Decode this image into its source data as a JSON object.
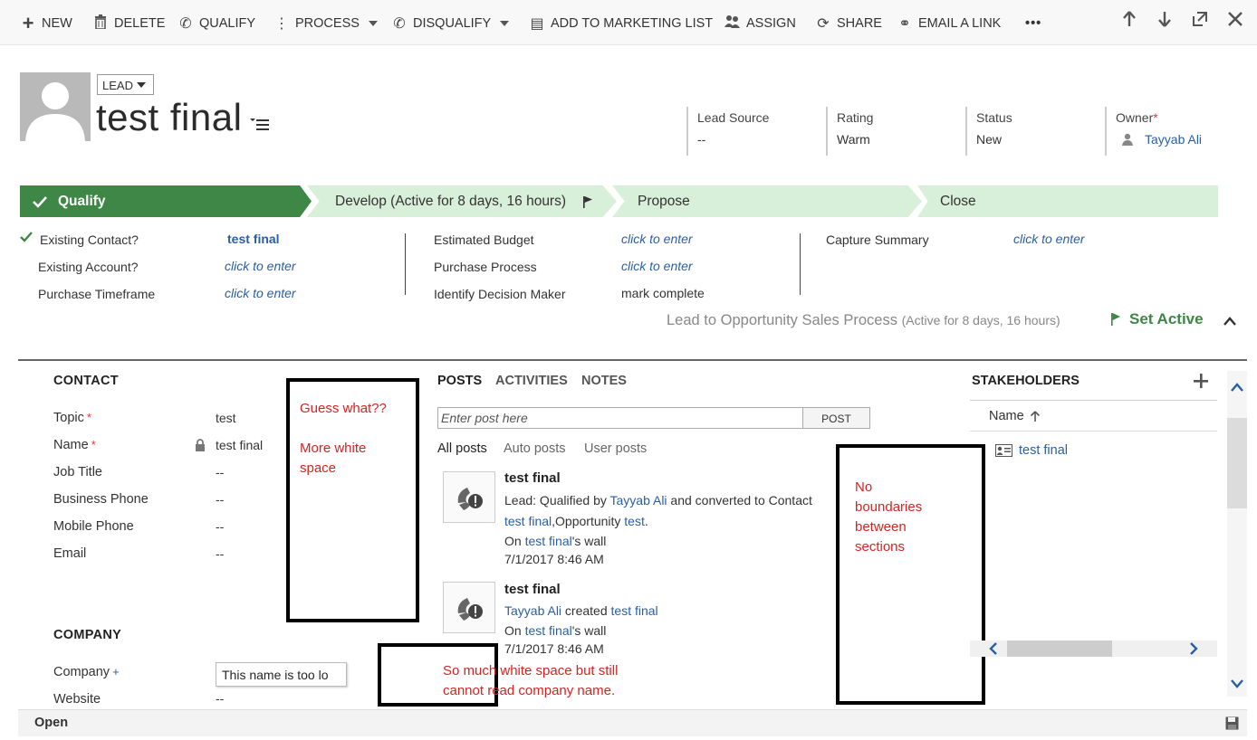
{
  "commands": [
    {
      "label": "NEW",
      "icon": "+"
    },
    {
      "label": "DELETE",
      "icon": "🗑"
    },
    {
      "label": "QUALIFY",
      "icon": "✆"
    },
    {
      "label": "PROCESS",
      "icon": "⋮"
    },
    {
      "label": "DISQUALIFY",
      "icon": "✆"
    },
    {
      "label": "ADD TO MARKETING LIST",
      "icon": "▤"
    },
    {
      "label": "ASSIGN",
      "icon": "👥"
    },
    {
      "label": "SHARE",
      "icon": "⟳"
    },
    {
      "label": "EMAIL A LINK",
      "icon": "⚭"
    },
    {
      "label": "•••",
      "icon": ""
    }
  ],
  "nav": {
    "up": "🡡",
    "down": "🡣",
    "popout": "⇱",
    "close": "✕"
  },
  "header": {
    "entity_type": "LEAD",
    "title": "test final",
    "fields": {
      "lead_source": {
        "label": "Lead Source",
        "value": "--"
      },
      "rating": {
        "label": "Rating",
        "value": "Warm"
      },
      "status": {
        "label": "Status",
        "value": "New"
      },
      "owner": {
        "label": "Owner",
        "required": "*",
        "value": "Tayyab Ali"
      }
    }
  },
  "process": {
    "stages": [
      "Qualify",
      "Develop (Active for 8 days, 16 hours)",
      "Propose",
      "Close"
    ],
    "steps": {
      "existing_contact": {
        "label": "Existing Contact?",
        "value": "test final"
      },
      "existing_account": {
        "label": "Existing Account?",
        "value": "click to enter"
      },
      "purchase_timeframe": {
        "label": "Purchase Timeframe",
        "value": "click to enter"
      },
      "estimated_budget": {
        "label": "Estimated Budget",
        "value": "click to enter"
      },
      "purchase_process": {
        "label": "Purchase Process",
        "value": "click to enter"
      },
      "identify_decision_maker": {
        "label": "Identify Decision Maker",
        "value": "mark complete"
      },
      "capture_summary": {
        "label": "Capture Summary",
        "value": "click to enter"
      }
    },
    "name": "Lead to Opportunity Sales Process",
    "active_note": "(Active for 8 days, 16 hours)",
    "set_active": "Set Active"
  },
  "contact": {
    "heading": "CONTACT",
    "fields": [
      {
        "label": "Topic",
        "required": "*",
        "value": "test"
      },
      {
        "label": "Name",
        "required": "*",
        "value": "test final"
      },
      {
        "label": "Job Title",
        "value": "--"
      },
      {
        "label": "Business Phone",
        "value": "--"
      },
      {
        "label": "Mobile Phone",
        "value": "--"
      },
      {
        "label": "Email",
        "value": "--"
      }
    ]
  },
  "company": {
    "heading": "COMPANY",
    "company_label": "Company",
    "company_req": "+",
    "company_value": "This name is too lo",
    "website_label": "Website",
    "website_value": "--"
  },
  "annotations": {
    "a1_line1": "Guess what??",
    "a1_line2": "More white",
    "a1_line3": "space",
    "a2_line1": "So much white space but still",
    "a2_line2": "cannot read company name.",
    "a3_line1": "No",
    "a3_line2": "boundaries",
    "a3_line3": "between",
    "a3_line4": "sections"
  },
  "posts": {
    "tabs": [
      "POSTS",
      "ACTIVITIES",
      "NOTES"
    ],
    "placeholder": "Enter post here",
    "post_button": "POST",
    "filters": [
      "All posts",
      "Auto posts",
      "User posts"
    ],
    "items": [
      {
        "title": "test final",
        "l1a": "Lead: Qualified by ",
        "l1b": "Tayyab Ali",
        "l1c": " and converted to Contact",
        "l2a": "test final",
        "l2b": ",Opportunity ",
        "l2c": "test",
        "l2d": ".",
        "wall_a": "On ",
        "wall_b": "test final",
        "wall_c": "'s wall",
        "time": "7/1/2017 8:46 AM"
      },
      {
        "title": "test final",
        "l1a": "Tayyab Ali",
        "l1b": " created ",
        "l1c": "test final",
        "wall_a": "On ",
        "wall_b": "test final",
        "wall_c": "'s wall",
        "time": "7/1/2017 8:46 AM"
      }
    ]
  },
  "stakeholders": {
    "heading": "STAKEHOLDERS",
    "column": "Name",
    "rows": [
      "test final"
    ]
  },
  "footer": {
    "status": "Open"
  }
}
